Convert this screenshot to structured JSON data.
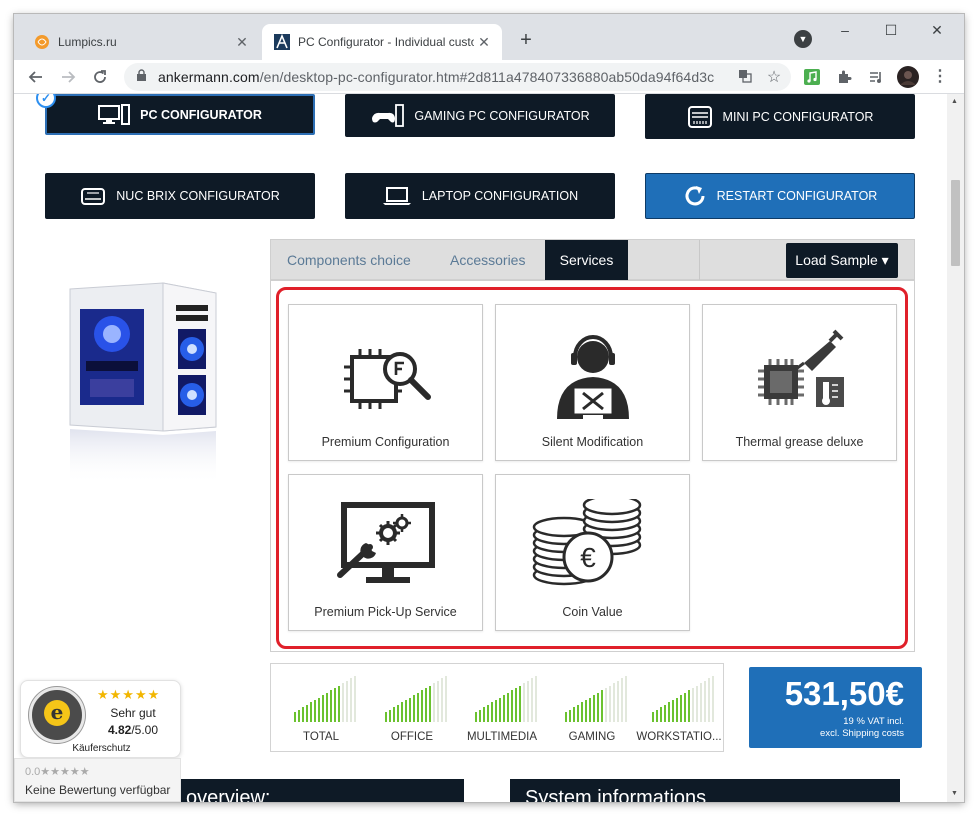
{
  "browser": {
    "tabs": [
      {
        "title": "Lumpics.ru",
        "active": false
      },
      {
        "title": "PC Configurator - Individual custom PC",
        "active": true
      }
    ],
    "url_domain": "ankermann.com",
    "url_path": "/en/desktop-pc-configurator.htm#2d811a478407336880ab50da94f64d3c",
    "new_tab": "+",
    "close_glyph": "✕",
    "window_controls": [
      "–",
      "☐",
      "✕"
    ]
  },
  "configurators": {
    "pc": "PC CONFIGURATOR",
    "gaming": "GAMING PC CONFIGURATOR",
    "mini": "MINI PC CONFIGURATOR",
    "nuc": "NUC BRIX CONFIGURATOR",
    "laptop": "LAPTOP CONFIGURATION",
    "restart": "RESTART CONFIGURATOR"
  },
  "tabs": {
    "components": "Components choice",
    "accessories": "Accessories",
    "services": "Services",
    "load_sample": "Load Sample ▾"
  },
  "services": [
    {
      "label": "Premium Configuration",
      "icon": "cpu-search-icon"
    },
    {
      "label": "Silent Modification",
      "icon": "technician-icon"
    },
    {
      "label": "Thermal grease deluxe",
      "icon": "thermal-paste-icon"
    },
    {
      "label": "Premium Pick-Up Service",
      "icon": "monitor-gears-icon"
    },
    {
      "label": "Coin Value",
      "icon": "euro-coins-icon"
    }
  ],
  "trusted_shops": {
    "stars": "★★★★★",
    "rating_text": "Sehr gut",
    "score": "4.82",
    "max": "/5.00",
    "label": "Käuferschutz",
    "review_stars": "0.0★★★★★",
    "review_text": "Keine Bewertung verfügbar"
  },
  "performance": {
    "categories": [
      "TOTAL",
      "OFFICE",
      "MULTIMEDIA",
      "GAMING",
      "WORKSTATIO..."
    ],
    "levels": [
      0.75,
      0.75,
      0.75,
      0.65,
      0.6
    ]
  },
  "price": {
    "amount": "531,50€",
    "vat": "19 % VAT incl.",
    "shipping": "excl. Shipping costs"
  },
  "sections": {
    "overview": "overview:",
    "system": "System informations"
  },
  "colors": {
    "dark_button": "#0e1a26",
    "accent_blue": "#1f6fb8",
    "highlight_red": "#e0202a",
    "meter_green": "#6bc22f"
  }
}
